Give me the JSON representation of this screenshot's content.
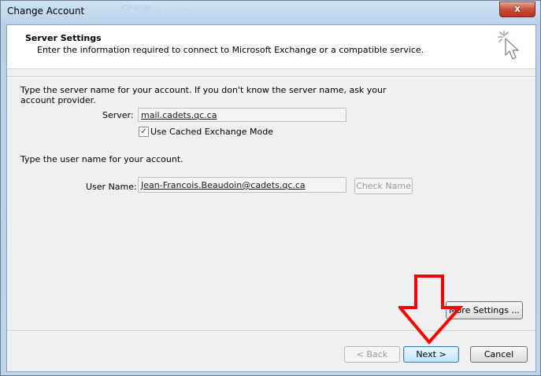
{
  "window": {
    "title": "Change Account",
    "background_tabs": [
      "Change...",
      "...",
      "..."
    ],
    "close_label": "x"
  },
  "header": {
    "title": "Server Settings",
    "description": "Enter the information required to connect to Microsoft Exchange or a compatible service.",
    "icon": "cursor-sparkle-icon"
  },
  "server_section": {
    "instructions_line1": "Type the server name for your account. If you don't know the server name, ask your",
    "instructions_line2": "account provider.",
    "server_label": "Server:",
    "server_value": "mail.cadets.qc.ca",
    "cached_mode_label": "Use Cached Exchange Mode",
    "cached_mode_checked": true,
    "check_glyph": "✓"
  },
  "user_section": {
    "instructions": "Type the user name for your account.",
    "username_label": "User Name:",
    "username_value": "Jean-Francois.Beaudoin@cadets.qc.ca",
    "check_name_label": "Check Name"
  },
  "buttons": {
    "more_settings_label": "More Settings ...",
    "back_label": "< Back",
    "next_label": "Next >",
    "cancel_label": "Cancel"
  },
  "annotation": {
    "arrow_color": "#ff0000",
    "arrow_icon": "red-down-arrow-annotation"
  }
}
